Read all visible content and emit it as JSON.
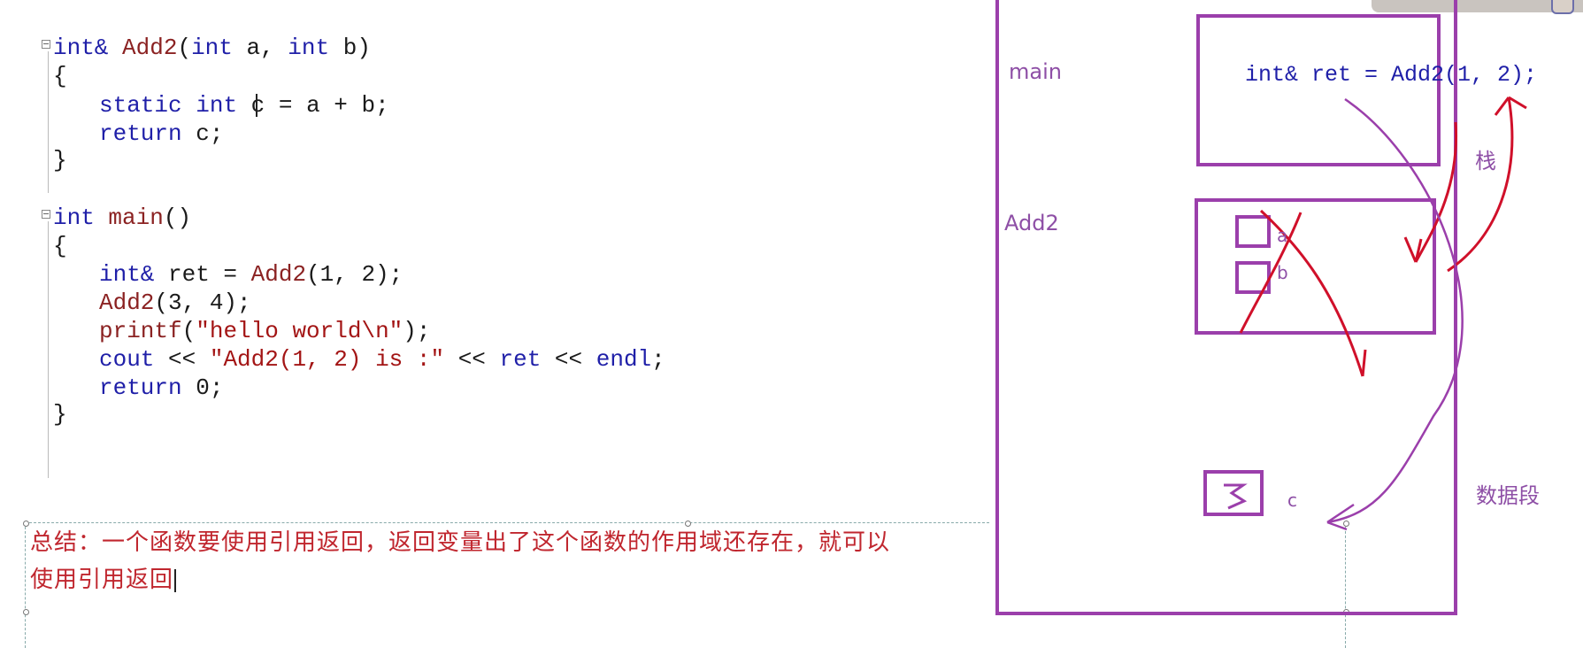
{
  "code": {
    "add2": {
      "signature": {
        "ret_type": "int&",
        "name": "Add2",
        "open": "(",
        "p1_type": "int",
        "p1": " a, ",
        "p2_type": "int",
        "p2": " b)"
      },
      "open_brace": "{",
      "line1": {
        "kw1": "static",
        "kw2": "int",
        "rest1": " c =",
        "rest2": " a + b;"
      },
      "line2": {
        "kw": "return",
        "rest": " c;"
      },
      "close_brace": "}"
    },
    "main": {
      "signature": {
        "ret_type": "int",
        "name": "main",
        "rest": "()"
      },
      "open_brace": "{",
      "line1": {
        "kw": "int&",
        "mid": " ret = ",
        "fn": "Add2",
        "args": "(1, 2);"
      },
      "line2": {
        "fn": "Add2",
        "args": "(3, 4);"
      },
      "line3": {
        "fn": "printf",
        "open": "(",
        "str": "\"hello world\\n\"",
        "close": ");"
      },
      "line4": {
        "kw": "cout",
        "op1": " << ",
        "str": "\"Add2(1, 2) is :\"",
        "op2": " << ",
        "kw2": "ret",
        "op3": " << ",
        "kw3": "endl",
        "end": ";"
      },
      "line5": {
        "kw": "return",
        "rest": " 0;"
      },
      "close_brace": "}"
    }
  },
  "summary": {
    "line1": "总结：一个函数要使用引用返回，返回变量出了这个函数的作用域还存在，就可以",
    "line2": "使用引用返回"
  },
  "diagram": {
    "label_main": "main",
    "label_add2": "Add2",
    "label_stack": "栈",
    "label_data_segment": "数据段",
    "main_frame_code": "int& ret = Add2(1, 2);",
    "param_a": "a",
    "param_b": "b",
    "static_var": "c",
    "static_value": "3",
    "colors": {
      "frame": "#9b3fab",
      "annotation": "#d0102a",
      "label": "#8e4fa6"
    }
  }
}
